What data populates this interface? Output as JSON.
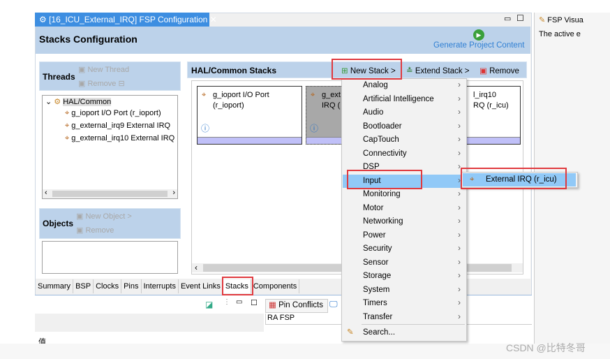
{
  "editor": {
    "tab_title": "[16_ICU_External_IRQ] FSP Configuration",
    "title": "Stacks Configuration",
    "generate_label": "Generate Project Content"
  },
  "side_panel": {
    "title": "FSP Visua",
    "text": "The active e"
  },
  "threads": {
    "title": "Threads",
    "new_label": "New Thread",
    "remove_label": "Remove",
    "tree": {
      "root": "HAL/Common",
      "children": [
        "g_ioport I/O Port (r_ioport)",
        "g_external_irq9 External IRQ",
        "g_external_irq10 External IRQ"
      ]
    }
  },
  "objects": {
    "title": "Objects",
    "new_label": "New Object >",
    "remove_label": "Remove"
  },
  "stacks": {
    "title": "HAL/Common Stacks",
    "new_stack": "New Stack >",
    "extend_stack": "Extend Stack >",
    "remove": "Remove",
    "cards": [
      {
        "line1": "g_ioport I/O Port",
        "line2": "(r_ioport)"
      },
      {
        "line1": "g_ext",
        "line2": "IRQ ("
      },
      {
        "line1": "l_irq10",
        "line2": "RQ (r_icu)"
      }
    ]
  },
  "bottom_tabs": [
    "Summary",
    "BSP",
    "Clocks",
    "Pins",
    "Interrupts",
    "Event Links",
    "Stacks",
    "Components"
  ],
  "active_tab": "Stacks",
  "lower": {
    "pin_conflicts": "Pin Conflicts",
    "ra_fsp": "RA FSP",
    "value_col": "值"
  },
  "menu": {
    "items": [
      "Analog",
      "Artificial Intelligence",
      "Audio",
      "Bootloader",
      "CapTouch",
      "Connectivity",
      "DSP",
      "Input",
      "Monitoring",
      "Motor",
      "Networking",
      "Power",
      "Security",
      "Sensor",
      "Storage",
      "System",
      "Timers",
      "Transfer"
    ],
    "selected": "Input",
    "search": "Search..."
  },
  "submenu": {
    "item": "External IRQ (r_icu)"
  },
  "watermark": "CSDN @比特冬哥",
  "colors": {
    "accent": "#3d8ee1",
    "header": "#bcd2ea",
    "highlight": "#91c9f7",
    "annotation": "#e0393e"
  }
}
